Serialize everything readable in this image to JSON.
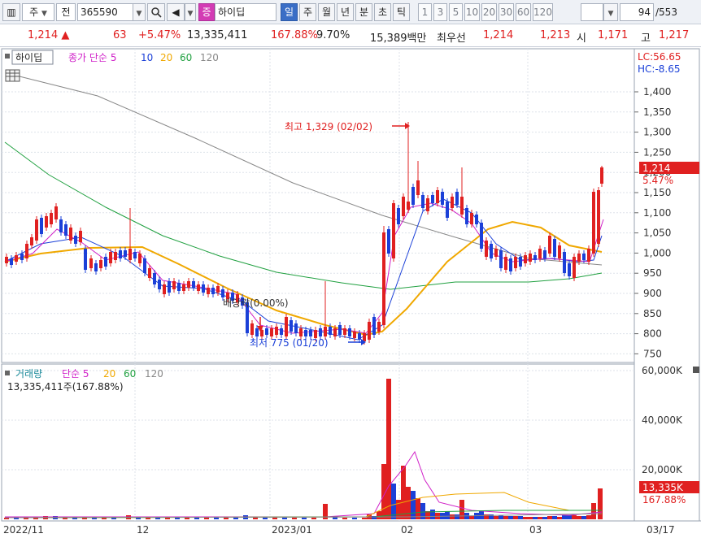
{
  "toolbar": {
    "market_label": "주",
    "type_label": "전",
    "code": "365590",
    "search_label": "Q",
    "name_badge": "증",
    "stock_name": "하이딥",
    "periods": [
      "일",
      "주",
      "월",
      "년",
      "분",
      "초",
      "틱"
    ],
    "active_period": "일",
    "intervals": [
      "1",
      "3",
      "5",
      "10",
      "20",
      "30",
      "60",
      "120"
    ],
    "count": "94",
    "total": "/553"
  },
  "quote": {
    "price": "1,214",
    "change": "63",
    "change_pct": "+5.47%",
    "volume": "13,335,411",
    "volume_ratio": "167.88%",
    "turnover": "9.70%",
    "amount": "15,389백만",
    "bid_label": "최우선",
    "ask": "1,214",
    "bid": "1,213",
    "open_label": "시",
    "open": "1,171",
    "high_label": "고",
    "high": "1,217"
  },
  "price_pane": {
    "name_label": "하이딥",
    "ma_prefix": "종가 단순",
    "ma_periods": [
      "5",
      "10",
      "20",
      "60",
      "120"
    ],
    "lc_label": "LC:56.65",
    "hc_label": "HC:-8.65",
    "y_ticks": [
      "1,400",
      "1,350",
      "1,300",
      "1,250",
      "1,200",
      "1,150",
      "1,100",
      "1,050",
      "1,000",
      "950",
      "900",
      "850",
      "800",
      "750"
    ],
    "last_price_label": "1,214",
    "last_pct_label": "5.47%",
    "high_annotation": "최고 1,329 (02/02)",
    "low_annotation": "최저 775 (01/20)",
    "ex_label": "배당락(0.00%)"
  },
  "volume_pane": {
    "label": "거래량",
    "ma_prefix": "단순",
    "ma_periods": [
      "5",
      "20",
      "60",
      "120"
    ],
    "summary": "13,335,411주(167.88%)",
    "y_ticks": [
      "60,000K",
      "40,000K",
      "20,000K"
    ],
    "last_vol_label": "13,335K",
    "last_ratio_label": "167.88%"
  },
  "x_axis": {
    "labels": [
      "2022/11",
      "12",
      "2023/01",
      "02",
      "03",
      "03/17"
    ]
  },
  "colors": {
    "up": "#e02020",
    "down": "#1b40d8",
    "ma5": "#d020c8",
    "ma10": "#1b40d8",
    "ma20": "#f0a800",
    "ma60": "#20a040",
    "ma120": "#888888"
  },
  "icons": [
    "chart-type-icon",
    "search-icon",
    "sound-icon",
    "table-icon",
    "settings-icon"
  ]
}
